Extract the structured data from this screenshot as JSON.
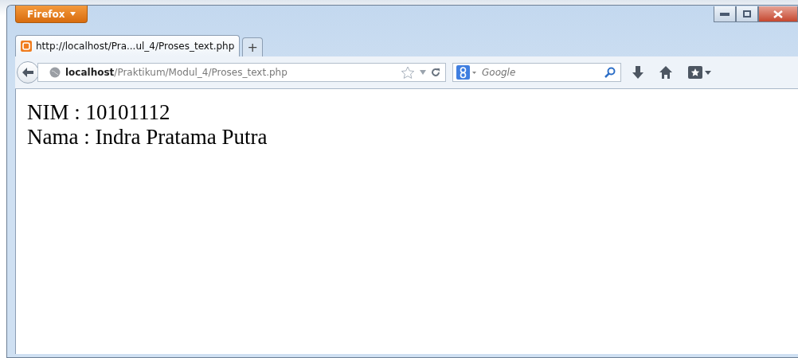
{
  "app_button": {
    "label": "Firefox"
  },
  "tabs": [
    {
      "title": "http://localhost/Pra...ul_4/Proses_text.php",
      "selected": true
    }
  ],
  "new_tab": {
    "label": "+"
  },
  "address_bar": {
    "value": "**localhost**/Praktikum/Modul_4/Proses_text.php"
  },
  "search": {
    "placeholder": "Google"
  },
  "content": {
    "lines": [
      "NIM : 10101112",
      "Nama : Indra Pratama Putra"
    ]
  }
}
